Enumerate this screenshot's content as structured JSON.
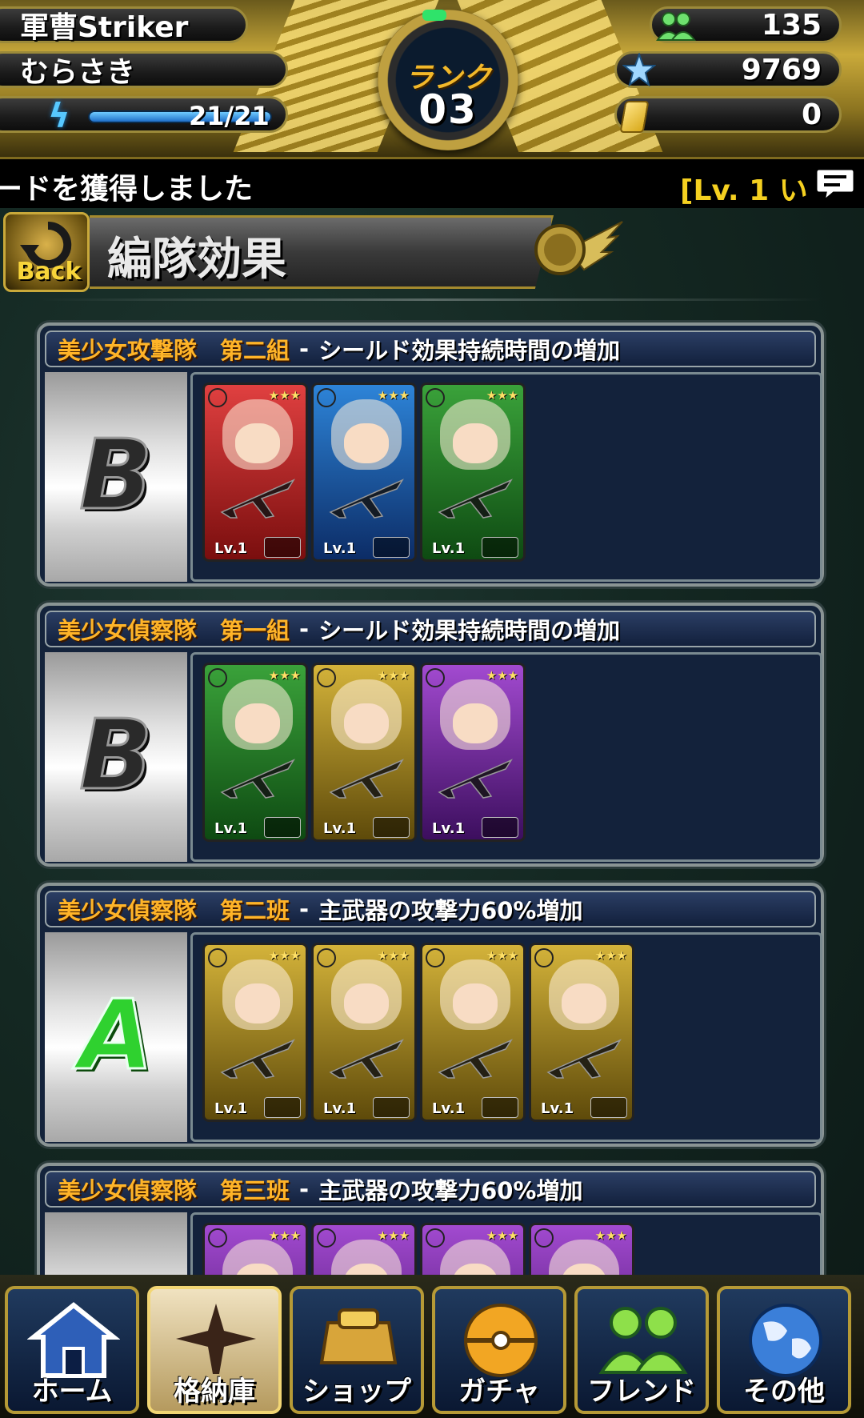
{
  "header": {
    "player_title": "軍曹Striker",
    "player_name": "むらさき",
    "stamina": "21/21",
    "stamina_ratio": 1.0,
    "rank_label": "ランク",
    "rank_value": "03",
    "friends": "135",
    "points": "9769",
    "cards": "0"
  },
  "ticker": {
    "message": "ードを獲得しました",
    "level_text": "[Lv. 1 い"
  },
  "page": {
    "back_label": "Back",
    "title": "編隊効果"
  },
  "formations": [
    {
      "group": "美少女攻撃隊　第二組",
      "separator": "-",
      "effect": "シールド効果持続時間の増加",
      "grade": "B",
      "cards": [
        {
          "color": "red",
          "level": "Lv.1"
        },
        {
          "color": "blue",
          "level": "Lv.1"
        },
        {
          "color": "green",
          "level": "Lv.1"
        }
      ]
    },
    {
      "group": "美少女偵察隊　第一組",
      "separator": "-",
      "effect": "シールド効果持続時間の増加",
      "grade": "B",
      "cards": [
        {
          "color": "green",
          "level": "Lv.1"
        },
        {
          "color": "yellow",
          "level": "Lv.1"
        },
        {
          "color": "purple",
          "level": "Lv.1"
        }
      ]
    },
    {
      "group": "美少女偵察隊　第二班",
      "separator": "-",
      "effect": "主武器の攻撃力60%増加",
      "grade": "A",
      "cards": [
        {
          "color": "yellow",
          "level": "Lv.1"
        },
        {
          "color": "yellow",
          "level": "Lv.1"
        },
        {
          "color": "yellow",
          "level": "Lv.1"
        },
        {
          "color": "yellow",
          "level": "Lv.1"
        }
      ]
    },
    {
      "group": "美少女偵察隊　第三班",
      "separator": "-",
      "effect": "主武器の攻撃力60%増加",
      "grade": "",
      "cards": [
        {
          "color": "purple",
          "level": ""
        },
        {
          "color": "purple",
          "level": ""
        },
        {
          "color": "purple",
          "level": ""
        },
        {
          "color": "purple",
          "level": ""
        }
      ]
    }
  ],
  "nav": [
    {
      "label": "ホーム",
      "icon": "home-icon",
      "active": false
    },
    {
      "label": "格納庫",
      "icon": "hangar-icon",
      "active": true
    },
    {
      "label": "ショップ",
      "icon": "shop-icon",
      "active": false
    },
    {
      "label": "ガチャ",
      "icon": "gacha-icon",
      "active": false
    },
    {
      "label": "フレンド",
      "icon": "friends-icon",
      "active": false
    },
    {
      "label": "その他",
      "icon": "globe-icon",
      "active": false
    }
  ]
}
